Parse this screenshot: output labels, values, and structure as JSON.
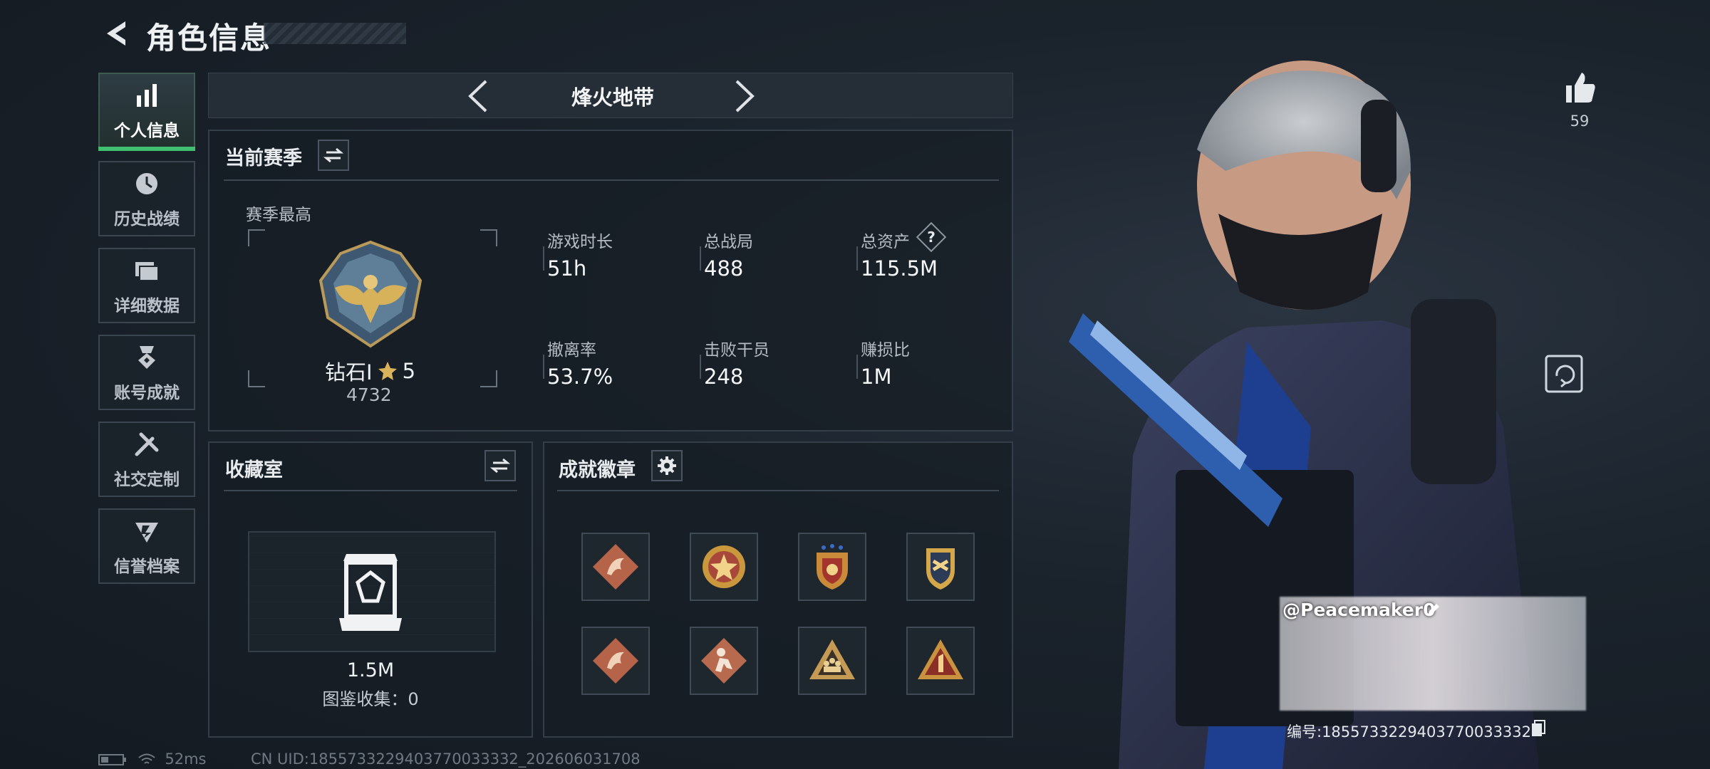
{
  "header": {
    "title": "角色信息"
  },
  "sidebar": {
    "items": [
      {
        "label": "个人信息",
        "icon": "bar-chart-icon",
        "active": true
      },
      {
        "label": "历史战绩",
        "icon": "clock-icon"
      },
      {
        "label": "详细数据",
        "icon": "folders-icon"
      },
      {
        "label": "账号成就",
        "icon": "medal-icon"
      },
      {
        "label": "社交定制",
        "icon": "tools-icon"
      },
      {
        "label": "信誉档案",
        "icon": "shield-icon"
      }
    ]
  },
  "mode": {
    "name": "烽火地带"
  },
  "season": {
    "title": "当前赛季",
    "best_label": "赛季最高",
    "rank": "钻石Ⅰ",
    "stars": "5",
    "score": "4732",
    "stats": [
      {
        "label": "游戏时长",
        "value": "51h"
      },
      {
        "label": "总战局",
        "value": "488"
      },
      {
        "label": "总资产",
        "value": "115.5M",
        "help": "?"
      },
      {
        "label": "撤离率",
        "value": "53.7%"
      },
      {
        "label": "击败干员",
        "value": "248"
      },
      {
        "label": "赚损比",
        "value": "1M"
      }
    ]
  },
  "collection": {
    "title": "收藏室",
    "value": "1.5M",
    "caption": "图鉴收集：0"
  },
  "badges": {
    "title": "成就徽章",
    "items": [
      {
        "icon": "dragon-badge-icon",
        "color": "#b5644a"
      },
      {
        "icon": "star-emblem-badge-icon",
        "color": "#c9973c"
      },
      {
        "icon": "shield-stars-badge-icon",
        "color": "#c98a3a"
      },
      {
        "icon": "winged-emblem-badge-icon",
        "color": "#d4a84a"
      },
      {
        "icon": "dragon-badge-icon",
        "color": "#b5644a"
      },
      {
        "icon": "operator-badge-icon",
        "color": "#b86a4e"
      },
      {
        "icon": "soldiers-triangle-badge-icon",
        "color": "#c49a55"
      },
      {
        "icon": "number-one-badge-icon",
        "color": "#c9923f"
      }
    ]
  },
  "likes": {
    "count": "59"
  },
  "player": {
    "name": "@Peacemaker0",
    "id": "编号:1855733229403770033332"
  },
  "status": {
    "ping": "52ms",
    "uid": "CN UID:1855733229403770033332_202606031708"
  },
  "colors": {
    "accent": "#3fbf6f",
    "panel_border": "#333e49",
    "gold": "#d4a84a"
  }
}
